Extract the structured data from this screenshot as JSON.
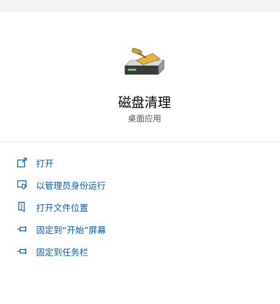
{
  "app": {
    "title": "磁盘清理",
    "subtitle": "桌面应用",
    "icon": "disk-cleanup-icon"
  },
  "colors": {
    "accent": "#0a5aa8",
    "top_strip": "#f3f3f3",
    "divider": "#e5e5e5"
  },
  "actions": [
    {
      "label": "打开",
      "icon": "open-icon"
    },
    {
      "label": "以管理员身份运行",
      "icon": "run-as-admin-icon"
    },
    {
      "label": "打开文件位置",
      "icon": "file-location-icon"
    },
    {
      "label": "固定到“开始”屏幕",
      "icon": "pin-icon"
    },
    {
      "label": "固定到任务栏",
      "icon": "pin-icon"
    }
  ]
}
